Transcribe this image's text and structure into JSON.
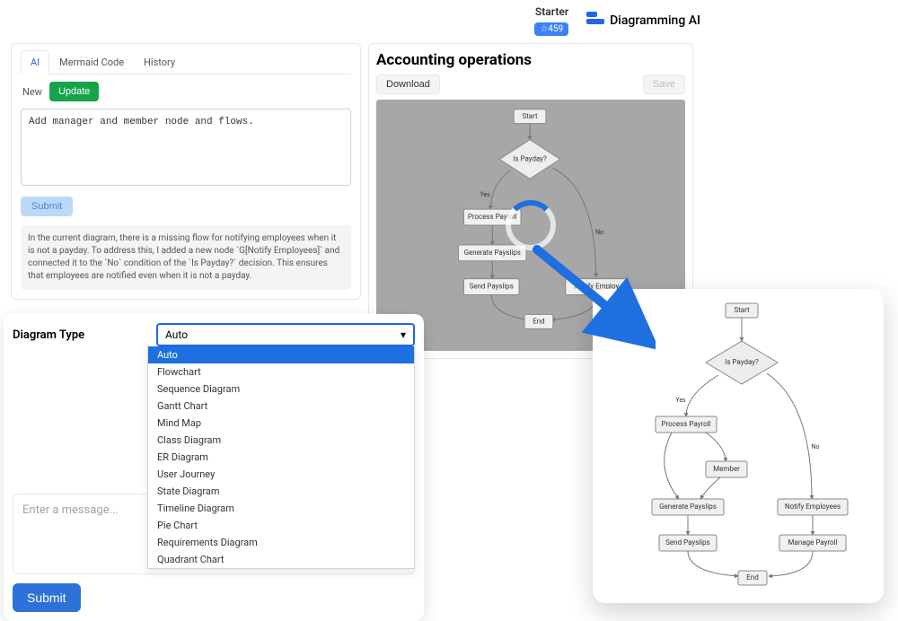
{
  "header": {
    "plan_label": "Starter",
    "badge": "☆459",
    "brand": "Diagramming AI"
  },
  "editor": {
    "tabs": [
      "AI",
      "Mermaid Code",
      "History"
    ],
    "active_tab_index": 0,
    "new_label": "New",
    "update_label": "Update",
    "instruction_value": "Add manager and member node and flows.",
    "submit_label": "Submit",
    "ai_response": "In the current diagram, there is a missing flow for notifying employees when it is not a payday. To address this, I added a new node `G[Notify Employees]` and connected it to the `No` condition of the `Is Payday?` decision. This ensures that employees are notified even when it is not a payday."
  },
  "diagram_type": {
    "label": "Diagram Type",
    "selected": "Auto",
    "options": [
      "Auto",
      "Flowchart",
      "Sequence Diagram",
      "Gantt Chart",
      "Mind Map",
      "Class Diagram",
      "ER Diagram",
      "User Journey",
      "State Diagram",
      "Timeline Diagram",
      "Pie Chart",
      "Requirements Diagram",
      "Quadrant Chart"
    ],
    "highlighted_index": 0,
    "message_placeholder": "Enter a message...",
    "submit_label": "Submit"
  },
  "preview": {
    "title": "Accounting operations",
    "download_label": "Download",
    "save_label": "Save",
    "loading": {
      "nodes": {
        "start": "Start",
        "decision": "Is Payday?",
        "yes": "Yes",
        "no": "No",
        "process_payroll": "Process Payroll",
        "generate_payslips": "Generate Payslips",
        "send_payslips": "Send Payslips",
        "notify": "Notify Employ",
        "end": "End"
      }
    }
  },
  "result": {
    "nodes": {
      "start": "Start",
      "decision": "Is Payday?",
      "yes": "Yes",
      "no": "No",
      "process_payroll": "Process Payroll",
      "member": "Member",
      "generate_payslips": "Generate Payslips",
      "send_payslips": "Send Payslips",
      "notify": "Notify Employees",
      "manage_payroll": "Manage Payroll",
      "end": "End"
    }
  }
}
